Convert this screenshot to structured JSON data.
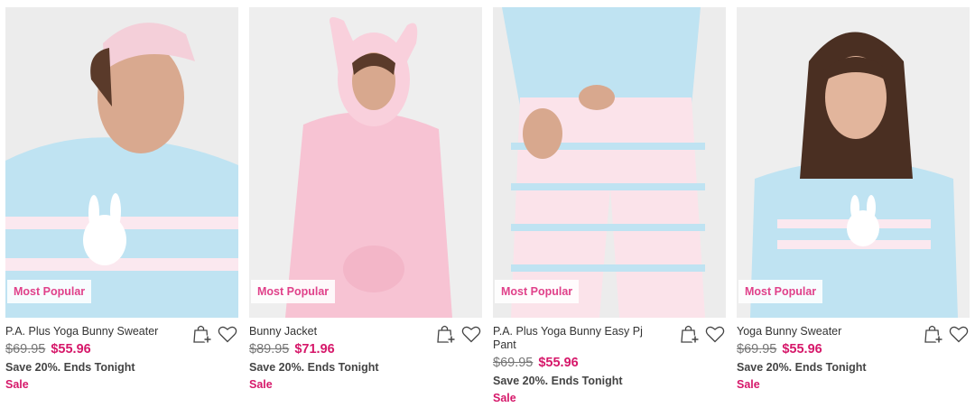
{
  "products": [
    {
      "badge": "Most Popular",
      "name": "P.A. Plus Yoga Bunny Sweater",
      "original_price": "$69.95",
      "sale_price": "$55.96",
      "promo": "Save 20%. Ends Tonight",
      "tag": "Sale"
    },
    {
      "badge": "Most Popular",
      "name": "Bunny Jacket",
      "original_price": "$89.95",
      "sale_price": "$71.96",
      "promo": "Save 20%. Ends Tonight",
      "tag": "Sale"
    },
    {
      "badge": "Most Popular",
      "name": "P.A. Plus Yoga Bunny Easy Pj Pant",
      "original_price": "$69.95",
      "sale_price": "$55.96",
      "promo": "Save 20%. Ends Tonight",
      "tag": "Sale"
    },
    {
      "badge": "Most Popular",
      "name": "Yoga Bunny Sweater",
      "original_price": "$69.95",
      "sale_price": "$55.96",
      "promo": "Save 20%. Ends Tonight",
      "tag": "Sale"
    }
  ],
  "icons": {
    "add_to_bag": "bag-plus-icon",
    "wishlist": "heart-icon"
  },
  "colors": {
    "accent": "#d6186a",
    "badge_text": "#e0418a",
    "sweater_blue": "#bfe3f2",
    "jacket_pink": "#f7c3d3"
  }
}
